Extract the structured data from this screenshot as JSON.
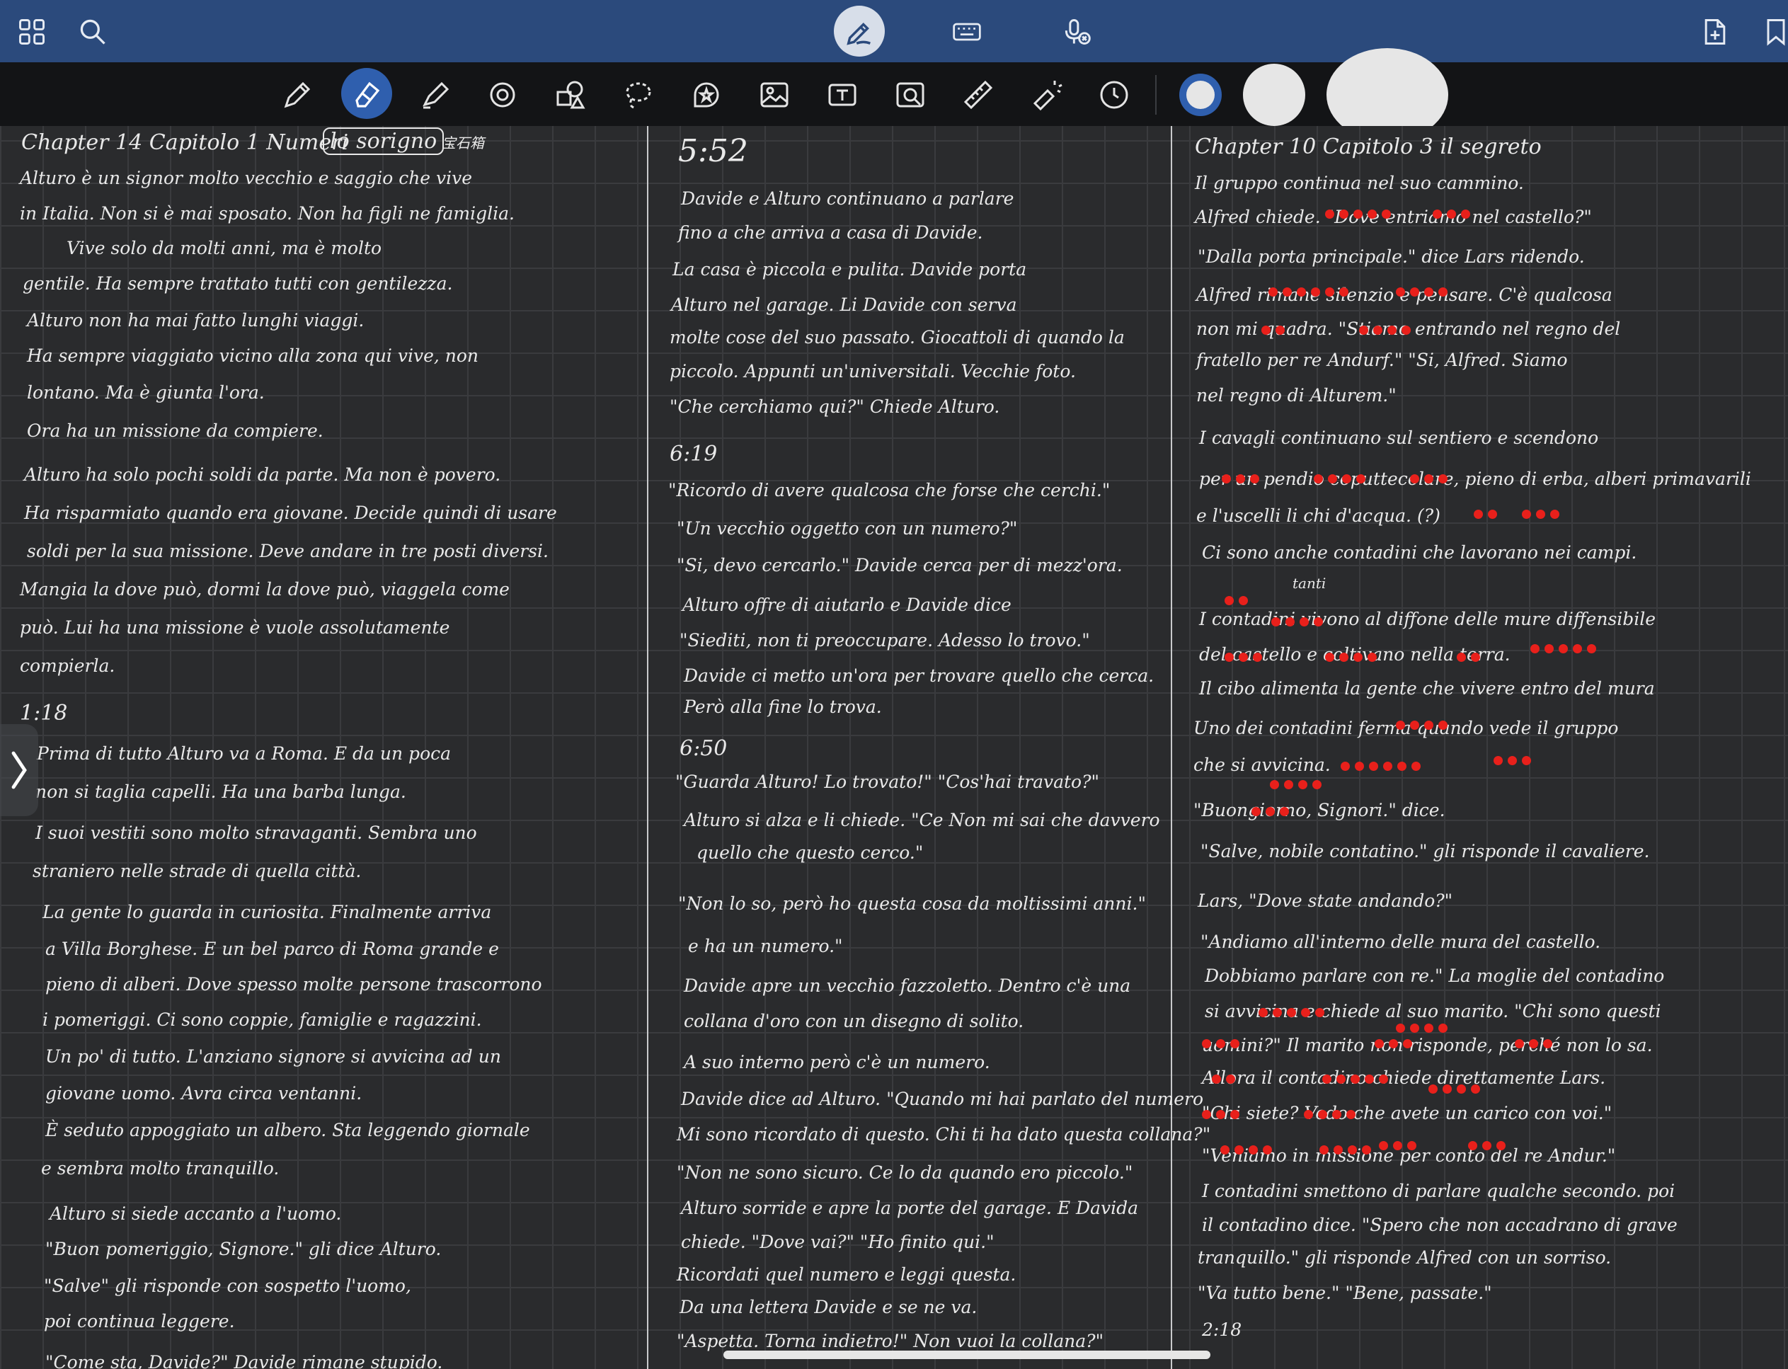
{
  "icons": {
    "grid": "grid-icon",
    "search": "search-icon",
    "pen_mode": "pen-mode-icon",
    "keyboard": "keyboard-icon",
    "mic": "mic-off-icon",
    "new_page": "new-page-icon",
    "bookmark": "bookmark-icon",
    "chevron": "chevron-right-icon"
  },
  "tools": [
    "pen",
    "eraser",
    "highlighter",
    "shape-detect",
    "shapes",
    "lasso",
    "sticker",
    "image",
    "text",
    "camera-scan",
    "ruler",
    "laser-pointer",
    "timer"
  ],
  "colors": {
    "nav": "#2b4a7c",
    "toolbar": "#131416",
    "active_tool": "#2f5fae",
    "page": "#2a2b2d",
    "ink": "#e9e9e9",
    "red_dots": "#e8201b"
  },
  "notes": {
    "col1": [
      "Chapter 14   Capitolo 1   Numeri",
      "lo sorigno",
      "宝石箱",
      "Alturo è un signor molto vecchio e saggio che vive",
      "in Italia. Non si è mai sposato. Non ha figli ne famiglia.",
      "Vive solo da molti anni, ma è molto",
      "gentile. Ha sempre trattato tutti con gentilezza.",
      "Alturo non ha mai fatto lunghi viaggi.",
      "Ha sempre viaggiato vicino alla zona qui vive, non",
      "lontano. Ma è giunta l'ora.",
      "Ora ha un missione da compiere.",
      "Alturo ha solo pochi soldi da parte. Ma non è povero.",
      "Ha risparmiato quando era giovane. Decide quindi di usare",
      "soldi per la sua missione. Deve andare in tre posti diversi.",
      "Mangia la dove può, dormi la dove può, viaggela come",
      "può. Lui ha una missione è vuole assolutamente",
      "compierla.",
      "1:18",
      "Prima di tutto Alturo va a Roma. E da un poca",
      "non si taglia capelli. Ha una barba lunga.",
      "I suoi vestiti sono molto stravaganti. Sembra uno",
      "straniero nelle strade di quella città.",
      "La gente lo guarda in curiosita. Finalmente arriva",
      "a Villa Borghese. E un bel parco di Roma grande e",
      "pieno di alberi. Dove spesso molte persone trascorrono",
      "i pomeriggi. Ci sono coppie, famiglie e ragazzini.",
      "Un po' di tutto. L'anziano signore si avvicina ad un",
      "giovane uomo. Avra circa ventanni.",
      "È seduto appoggiato un albero. Sta leggendo giornale",
      "e sembra molto tranquillo.",
      "Alturo si siede accanto a l'uomo.",
      "\"Buon pomeriggio, Signore.\" gli dice Alturo.",
      "\"Salve\" gli risponde con sospetto l'uomo,",
      "poi continua leggere.",
      "\"Come sta, Davide?\" Davide rimane stupido."
    ],
    "col2": [
      "5:52",
      "Davide e Alturo continuano a parlare",
      "fino a che arriva a casa di Davide.",
      "La casa è piccola e pulita. Davide porta",
      "Alturo nel garage. Li Davide con serva",
      "molte cose del suo passato. Giocattoli di quando la",
      "piccolo. Appunti un'universitali. Vecchie foto.",
      "\"Che cerchiamo qui?\" Chiede Alturo.",
      "6:19",
      "\"Ricordo di avere qualcosa che forse che cerchi.\"",
      "\"Un vecchio oggetto con un numero?\"",
      "\"Si, devo cercarlo.\" Davide cerca per di mezz'ora.",
      "Alturo offre di aiutarlo e Davide dice",
      "\"Siediti, non ti preoccupare. Adesso lo trovo.\"",
      "Davide ci metto un'ora per trovare quello che cerca.",
      "Però alla fine lo trova.",
      "6:50",
      "\"Guarda Alturo! Lo trovato!\" \"Cos'hai travato?\"",
      "Alturo si alza e li chiede. \"Ce Non mi sai che davvero",
      "quello che questo cerco.\"",
      "\"Non lo so, però ho questa cosa da moltissimi anni.\"",
      "e ha un numero.\"",
      "Davide apre un vecchio fazzoletto. Dentro c'è una",
      "collana d'oro con un disegno di solito.",
      "A suo interno però c'è un numero.",
      "Davide dice ad Alturo. \"Quando mi hai parlato del numero",
      "Mi sono ricordato di questo. Chi ti ha dato questa collana?\"",
      "\"Non ne sono sicuro. Ce lo da quando ero piccolo.\"",
      "Alturo sorride e apre la porte del garage. E Davida",
      "chiede. \"Dove vai?\" \"Ho finito qui.\"",
      "Ricordati quel numero e leggi questa.",
      "Da una lettera Davide e se ne va.",
      "\"Aspetta. Torna indietro!\" Non vuoi la collana?\""
    ],
    "col3": [
      "Chapter 10   Capitolo 3   il segreto",
      "Il gruppo continua nel suo cammino.",
      "Alfred chiede. \"Dove entriamo nel castello?\"",
      "\"Dalla porta principale.\" dice Lars ridendo.",
      "Alfred rimane silenzio e pensare. C'è qualcosa",
      "non mi quadra. \"Stiamo entrando nel regno del",
      "fratello per re Andurf.\" \"Si, Alfred. Siamo",
      "nel regno di Alturem.\"",
      "I cavagli continuano sul sentiero e scendono",
      "per un pendio coputtecolare, pieno di erba, alberi primavarili",
      "e l'uscelli li chi d'acqua. (?)",
      "Ci sono anche contadini che lavorano nei campi.",
      "tanti",
      "I contadini vivono al diffone delle mure diffensibile",
      "del castello e coltivano nella terra.",
      "Il cibo alimenta la gente che vivere entro del mura",
      "Uno dei contadini ferma quando vede il gruppo",
      "che si avvicina.",
      "\"Buongiorno, Signori.\" dice.",
      "\"Salve, nobile contatino.\" gli risponde il cavaliere.",
      "Lars, \"Dove state andando?\"",
      "\"Andiamo all'interno delle mura del castello.",
      "Dobbiamo parlare con re.\" La moglie del contadino",
      "si avvicina e chiede al suo marito. \"Chi sono questi",
      "uomini?\" Il marito non risponde, perché non lo sa.",
      "Allora il contadino chiede direttamente Lars.",
      "\"Chi siete? Vedo che avete un carico con voi.\"",
      "\"Veniamo in missione per conto del re Andur.\"",
      "I contadini smettono di parlare qualche secondo. poi",
      "il contadino dice. \"Spero che non accadrano di grave",
      "tranquillo.\" gli risponde Alfred con un sorriso.",
      "\"Va tutto bene.\" \"Bene, passate.\"",
      "2:18"
    ]
  }
}
